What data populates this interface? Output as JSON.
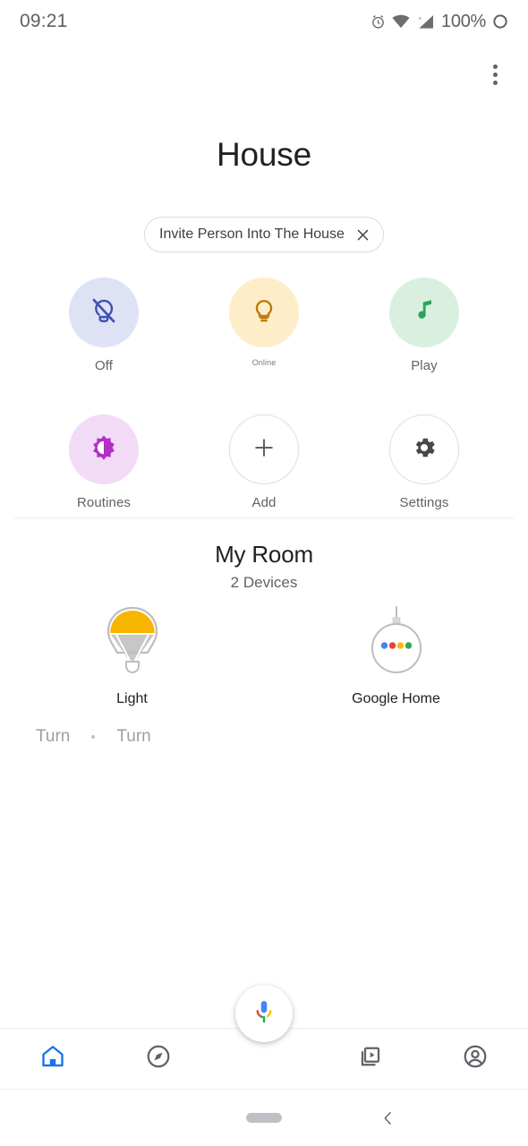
{
  "status_bar": {
    "time": "09:21",
    "battery_percent": "100%",
    "icons": [
      "alarm-icon",
      "wifi-icon",
      "cellular-signal-icon",
      "battery-icon"
    ]
  },
  "header": {
    "overflow_label": "more-options",
    "title": "House"
  },
  "invite_chip": {
    "label": "Invite Person Into The House",
    "close_label": "dismiss"
  },
  "quick_actions": [
    {
      "label": "Off",
      "icon": "lightbulb-off-icon",
      "bg": "#dfe2f5",
      "fg": "#3f51b5",
      "style": "filled",
      "small": false
    },
    {
      "label": "Online",
      "icon": "lightbulb-icon",
      "bg": "#fdeec9",
      "fg": "#c07b12",
      "style": "filled",
      "small": true
    },
    {
      "label": "Play",
      "icon": "music-note-icon",
      "bg": "#d9f0e1",
      "fg": "#2aa55b",
      "style": "filled",
      "small": false
    },
    {
      "label": "Routines",
      "icon": "brightness-icon",
      "bg": "#f2dbf7",
      "fg": "#b12fc4",
      "style": "filled",
      "small": false
    },
    {
      "label": "Add",
      "icon": "plus-icon",
      "bg": "#ffffff",
      "fg": "#5f6368",
      "style": "outlined",
      "small": false
    },
    {
      "label": "Settings",
      "icon": "gear-icon",
      "bg": "#ffffff",
      "fg": "#45484b",
      "style": "outlined",
      "small": false
    }
  ],
  "room": {
    "name": "My Room",
    "device_count": "2 Devices"
  },
  "devices": [
    {
      "label": "Light",
      "icon": "light-bulb-device-icon"
    },
    {
      "label": "Google Home",
      "icon": "google-home-speaker-icon"
    }
  ],
  "ghost_actions": {
    "left": "Turn",
    "right": "Turn"
  },
  "assistant": {
    "label": "Google Assistant",
    "icon": "google-mic-icon"
  },
  "bottom_nav": [
    {
      "name": "home",
      "icon": "home-icon",
      "active": true
    },
    {
      "name": "explore",
      "icon": "compass-icon",
      "active": false
    },
    {
      "name": "media",
      "icon": "media-library-icon",
      "active": false
    },
    {
      "name": "account",
      "icon": "account-circle-icon",
      "active": false
    }
  ],
  "system_nav": {
    "home_pill": "home-pill",
    "back": "back-chevron-icon"
  },
  "colors": {
    "accent_blue": "#1a73e8",
    "google_blue": "#4285f4",
    "google_red": "#ea4335",
    "google_yellow": "#fbbc04",
    "google_green": "#34a853",
    "text_primary": "#202124",
    "text_secondary": "#5f6368",
    "divider": "#e8eaed"
  }
}
